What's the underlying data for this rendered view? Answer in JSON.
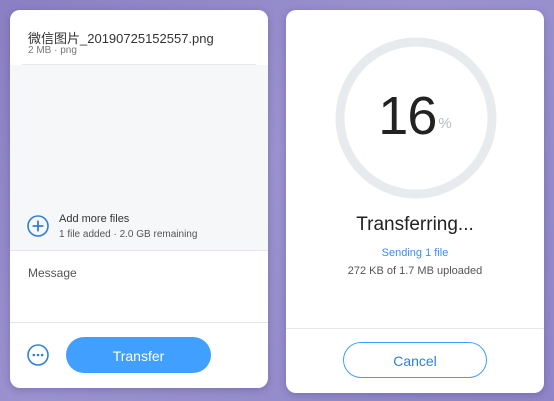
{
  "upload": {
    "file": {
      "name": "微信图片_20190725152557.png",
      "meta": "2 MB · png"
    },
    "add_more": {
      "label": "Add more files",
      "meta": "1 file added · 2.0 GB remaining",
      "icon": "plus-icon"
    },
    "message": {
      "placeholder": "Message",
      "value": ""
    },
    "more_icon": "more-horizontal-icon",
    "transfer_label": "Transfer"
  },
  "progress": {
    "percent_value": 16,
    "percent": "16",
    "percent_sign": "%",
    "status": "Transferring...",
    "sending": "Sending 1 file",
    "uploaded": "272 KB of 1.7 MB uploaded",
    "cancel_label": "Cancel"
  },
  "colors": {
    "background": "#8f85c8",
    "accent": "#409fff",
    "ring_track": "#e8ebee",
    "text_dark": "#222222"
  }
}
